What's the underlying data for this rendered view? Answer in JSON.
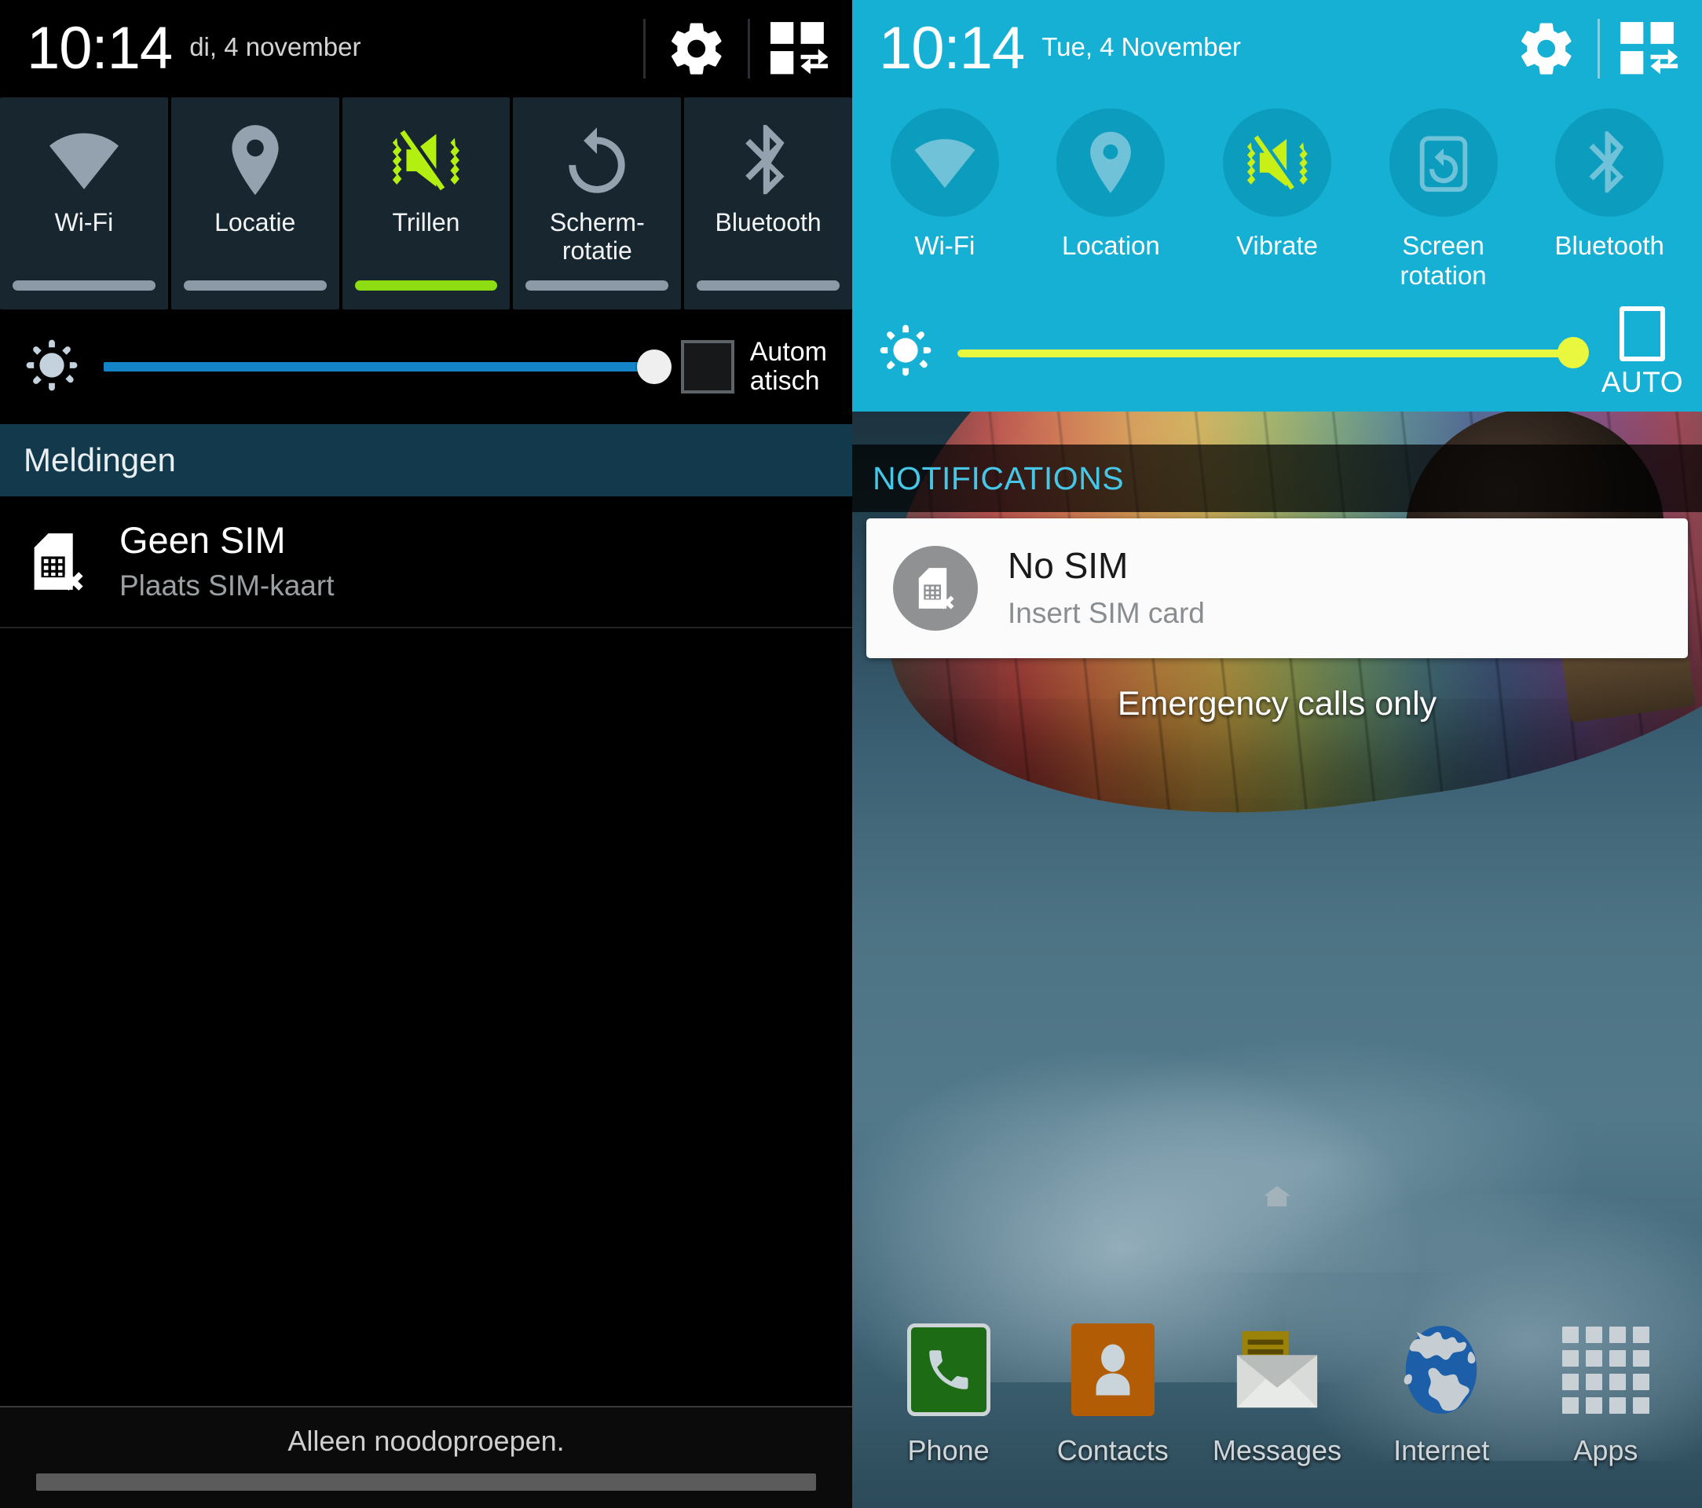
{
  "left_panel": {
    "language": "nl",
    "status_bar": {
      "time": "10:14",
      "date": "di, 4 november",
      "settings_icon": "gear-icon",
      "quick_toggle_icon": "quick-settings-grid-icon"
    },
    "quick_toggles": [
      {
        "label": "Wi-Fi",
        "icon": "wifi-icon",
        "active": false
      },
      {
        "label": "Locatie",
        "icon": "location-pin-icon",
        "active": false
      },
      {
        "label": "Trillen",
        "icon": "vibrate-mute-icon",
        "active": true
      },
      {
        "label": "Scherm-\nrotatie",
        "label_line1": "Scherm-",
        "label_line2": "rotatie",
        "icon": "screen-rotation-icon",
        "active": false
      },
      {
        "label": "Bluetooth",
        "icon": "bluetooth-icon",
        "active": false
      }
    ],
    "brightness": {
      "icon": "brightness-sun-icon",
      "value_percent": 100,
      "auto_label_line1": "Autom",
      "auto_label_line2": "atisch",
      "auto_checked": false
    },
    "notifications_header": "Meldingen",
    "notification": {
      "icon": "no-sim-card-icon",
      "title": "Geen SIM",
      "subtitle": "Plaats SIM-kaart"
    },
    "footer_status": "Alleen noodoproepen."
  },
  "right_panel": {
    "language": "en",
    "accent_color": "#16b0d4",
    "toggle_circle_color": "#0c9cbe",
    "slider_color": "#e9f73f",
    "status_bar": {
      "time": "10:14",
      "date": "Tue, 4 November",
      "settings_icon": "gear-icon",
      "quick_toggle_icon": "quick-settings-grid-icon"
    },
    "quick_toggles": [
      {
        "label": "Wi-Fi",
        "icon": "wifi-icon",
        "active": false
      },
      {
        "label": "Location",
        "icon": "location-pin-icon",
        "active": false
      },
      {
        "label": "Vibrate",
        "icon": "vibrate-mute-icon",
        "active": true
      },
      {
        "label": "Screen\nrotation",
        "label_line1": "Screen",
        "label_line2": "rotation",
        "icon": "screen-rotation-icon",
        "active": false
      },
      {
        "label": "Bluetooth",
        "icon": "bluetooth-icon",
        "active": false
      }
    ],
    "brightness": {
      "icon": "brightness-sun-icon",
      "value_percent": 100,
      "auto_label": "AUTO",
      "auto_checked": false
    },
    "notifications_header": "NOTIFICATIONS",
    "notification": {
      "icon": "no-sim-card-icon",
      "title": "No SIM",
      "subtitle": "Insert SIM card"
    },
    "emergency_text": "Emergency calls only",
    "dock": [
      {
        "label": "Phone",
        "icon": "phone-icon"
      },
      {
        "label": "Contacts",
        "icon": "contacts-icon"
      },
      {
        "label": "Messages",
        "icon": "messages-envelope-icon"
      },
      {
        "label": "Internet",
        "icon": "globe-icon"
      },
      {
        "label": "Apps",
        "icon": "apps-grid-icon"
      }
    ],
    "home_indicator_icon": "home-icon"
  }
}
